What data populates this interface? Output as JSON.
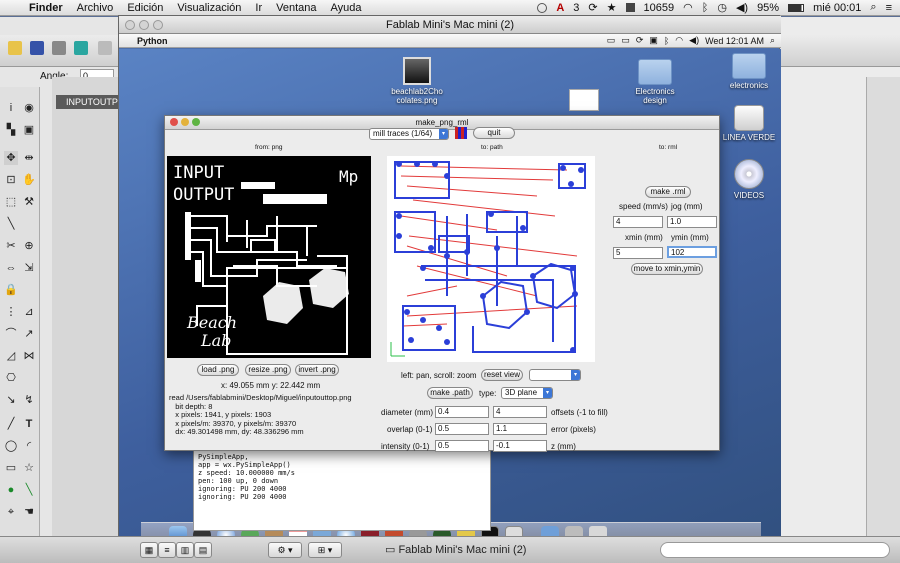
{
  "menubar": {
    "app": "Finder",
    "items": [
      "Archivo",
      "Edición",
      "Visualización",
      "Ir",
      "Ventana",
      "Ayuda"
    ],
    "status": [
      "3",
      "10659",
      "95%",
      "mié 00:01"
    ]
  },
  "left_app": {
    "angle_label": "Angle:",
    "angle_value": "0",
    "doc_tab": "INPUTOUTPUT"
  },
  "vnc_window": {
    "title": "Fablab Mini's Mac mini (2)"
  },
  "inner_menubar": {
    "app": "Python",
    "clock": "Wed 12:01 AM"
  },
  "desktop_icons": {
    "beach": "beachlab2Cho\ncolates.png",
    "electronics_design": "Electronics\ndesign",
    "electronics": "electronics",
    "linea_verde": "LINEA VERDE",
    "videos": "VIDEOS"
  },
  "terminal": [
    "PySimpleApp,",
    "  app = wx.PySimpleApp()",
    "z speed: 10.000000 mm/s",
    "pen: 100 up, 0 down",
    "ignoring: PU 200 4000",
    "ignoring: PU 200 4000"
  ],
  "make_png": {
    "title": "make_png_rml",
    "mode": "mill traces (1/64)",
    "quit": "quit",
    "from": "from: png",
    "to_path": "to: path",
    "to_rml": "to: rml",
    "board": {
      "line1": "INPUT",
      "line2": "OUTPUT",
      "mp": "Mp",
      "beach": "Beach",
      "lab": "Lab"
    },
    "buttons": {
      "load": "load .png",
      "resize": "resize .png",
      "invert": "invert .png",
      "make_path": "make .path",
      "reset_view": "reset view",
      "make_rml": "make .rml",
      "move": "move to xmin,ymin"
    },
    "coords": "x: 49.055 mm  y: 22.442 mm",
    "info": "read /Users/fablabmini/Desktop/Miguel/inputouttop.png\n   bit depth: 8\n   x pixels: 1941, y pixels: 1903\n   x pixels/m: 39370, y pixels/m: 39370\n   dx: 49.301498 mm, dy: 48.336296 mm",
    "view_hint": "left: pan, scroll: zoom",
    "type_label": "type:",
    "type_value": "3D plane",
    "diameter_label": "diameter (mm)",
    "diameter": "0.4",
    "offsets": "4",
    "offsets_label": "offsets (-1 to fill)",
    "overlap_label": "overlap (0-1)",
    "overlap": "0.5",
    "error": "1.1",
    "error_label": "error (pixels)",
    "intensity_label": "intensity (0-1)",
    "intensity": "0.5",
    "z": "-0.1",
    "z_label": "z (mm)",
    "speed_label": "speed (mm/s)",
    "speed": "4",
    "jog_label": "jog (mm)",
    "jog": "1.0",
    "xmin_label": "xmin (mm)",
    "xmin": "5",
    "ymin_label": "ymin (mm)",
    "ymin": "102"
  },
  "bottom_title": "Fablab Mini's Mac mini (2)"
}
